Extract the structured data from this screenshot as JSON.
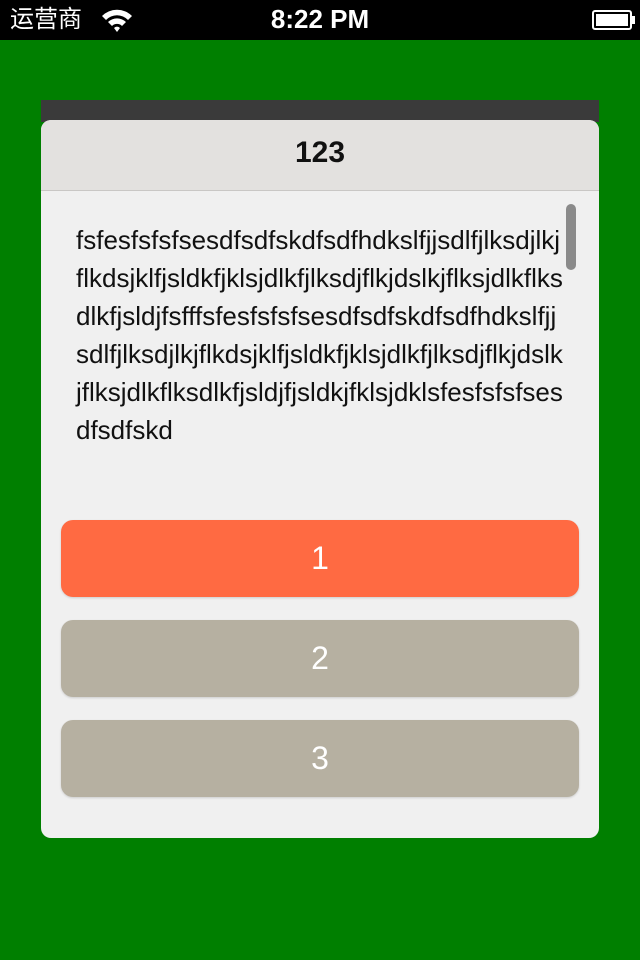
{
  "status_bar": {
    "carrier": "运营商",
    "time": "8:22 PM",
    "wifi_icon": "wifi-icon",
    "battery_icon": "battery-icon"
  },
  "dialog": {
    "title": "123",
    "message": "fsfesfsfsfsesdfsdfskdfsdfhdkslfjjsdlfjlksdjlkjflkdsjklfjsldkfjklsjdlkfjlksdjflkjdslkjflksjdlkflksdlkfjsldjfsfffsfesfsfsfsesdfsdfskdfsdfhdkslfjjsdlfjlksdjlkjflkdsjklfjsldkfjklsjdlkfjlksdjflkjdslkjflksjdlkflksdlkfjsldjfjsldkjfklsjdklsfesfsfsfsesdfsdfskd",
    "buttons": [
      "1",
      "2",
      "3"
    ]
  },
  "colors": {
    "background": "#007f00",
    "primary_button": "#ff6a42",
    "secondary_button": "#b6b0a1",
    "dialog_body": "#f0f0f0",
    "dialog_header": "#e3e1df"
  }
}
